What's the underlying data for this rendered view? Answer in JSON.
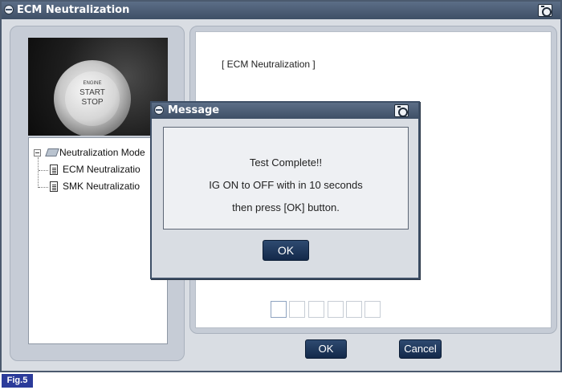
{
  "window": {
    "title": "ECM Neutralization"
  },
  "photo": {
    "line1": "ENGINE",
    "line2": "START",
    "line3": "STOP"
  },
  "tree": {
    "root": "Neutralization Mode",
    "items": [
      "ECM Neutralizatio",
      "SMK Neutralizatio"
    ]
  },
  "main": {
    "section_title": "[ ECM Neutralization ]"
  },
  "buttons": {
    "ok": "OK",
    "cancel": "Cancel"
  },
  "dialog": {
    "title": "Message",
    "lines": [
      "Test Complete!!",
      "IG ON to OFF with in 10 seconds",
      "then press [OK] button."
    ],
    "ok": "OK"
  },
  "figure_label": "Fig.5",
  "colors": {
    "titlebar": "#4b5c74",
    "button": "#1f3a5f",
    "panel": "#c6ccd6",
    "fig_label": "#2b3b9a"
  }
}
